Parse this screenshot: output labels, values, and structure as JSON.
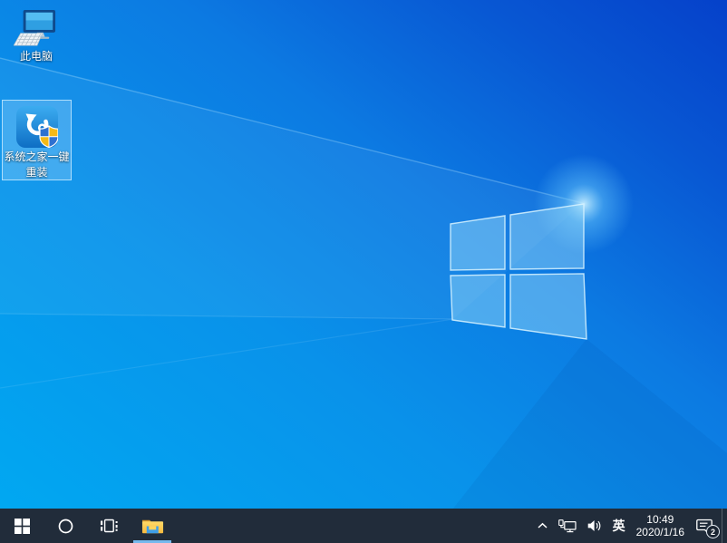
{
  "colors": {
    "taskbar-bg": "#212c3a",
    "explorer-underline": "#76b9ed",
    "selection-fill": "rgba(140,205,250,0.38)",
    "selection-border": "rgba(200,235,255,0.8)",
    "wallpaper-bright": "#00aaf2",
    "wallpaper-dark": "#0541ca",
    "folder-yellow": "#fdc94a",
    "folder-front-blue": "#3f9fe8",
    "shield-blue": "#2f71d0",
    "shield-yellow": "#f5b916",
    "app-icon-blue": "#1e88d8"
  },
  "desktop": {
    "icons": [
      {
        "id": "this-pc",
        "label": "此电脑",
        "icon": "computer-icon",
        "selected": false
      },
      {
        "id": "syshome-onekey-reinstall",
        "label_line1": "系统之家一键",
        "label_line2": "重装",
        "icon": "reinstall-app-icon",
        "selected": true
      }
    ],
    "wallpaper_logo": "windows-logo"
  },
  "taskbar": {
    "start": {
      "icon": "windows-start-icon"
    },
    "search": {
      "icon": "search-circle-icon"
    },
    "task_view": {
      "icon": "task-view-icon"
    },
    "file_explorer": {
      "icon": "folder-icon",
      "running": true
    },
    "tray": {
      "hidden_icons": {
        "icon": "chevron-up-icon"
      },
      "network": {
        "icon": "network-icon"
      },
      "volume": {
        "icon": "speaker-icon"
      },
      "language_indicator": "英",
      "clock": {
        "time": "10:49",
        "date": "2020/1/16"
      },
      "action_center": {
        "icon": "action-center-icon",
        "badge": "2"
      }
    }
  }
}
